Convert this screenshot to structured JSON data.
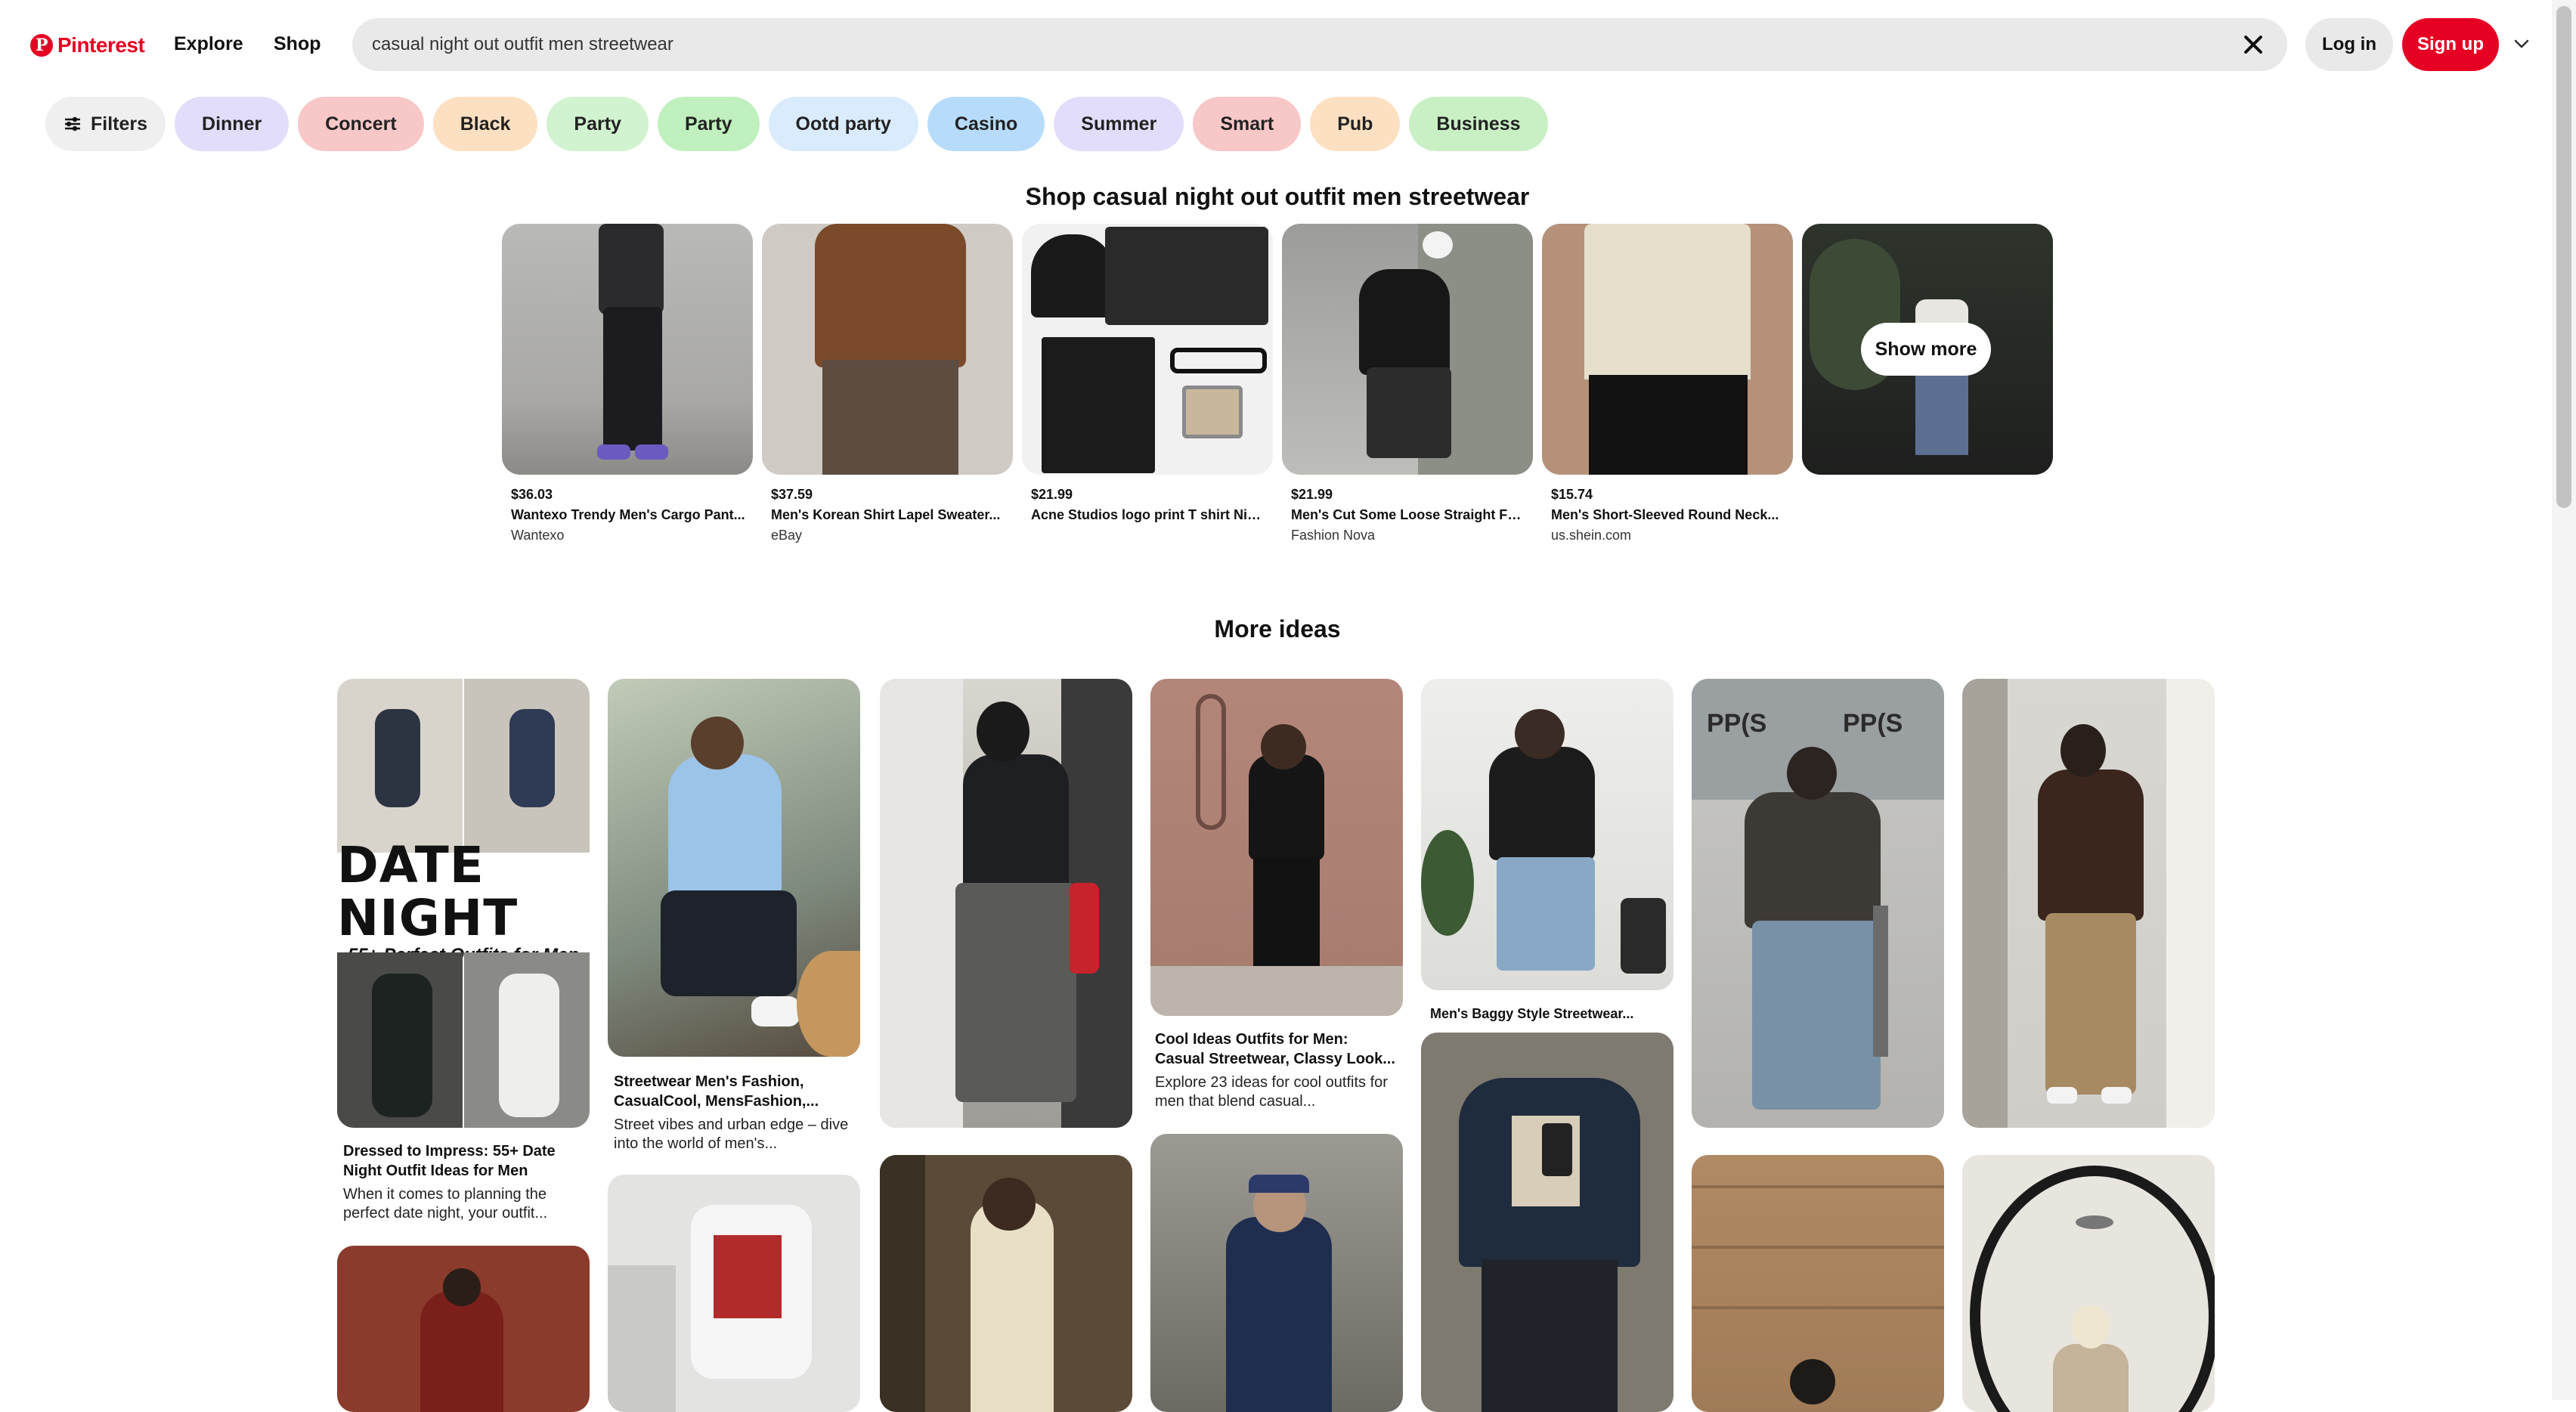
{
  "header": {
    "logo_text": "Pinterest",
    "nav": [
      "Explore",
      "Shop"
    ],
    "search_value": "casual night out outfit men streetwear",
    "login_label": "Log in",
    "signup_label": "Sign up",
    "brand_color": "#e60023"
  },
  "filters": {
    "filters_label": "Filters",
    "chips": [
      {
        "label": "Dinner",
        "color": "#e3ddfc"
      },
      {
        "label": "Concert",
        "color": "#f8c7c7"
      },
      {
        "label": "Black",
        "color": "#fde0c2"
      },
      {
        "label": "Party",
        "color": "#d2f3cf"
      },
      {
        "label": "Party",
        "color": "#bff0bd"
      },
      {
        "label": "Ootd party",
        "color": "#d9ebfd"
      },
      {
        "label": "Casino",
        "color": "#b7dcfb"
      },
      {
        "label": "Summer",
        "color": "#e3ddfc"
      },
      {
        "label": "Smart",
        "color": "#f8c7c7"
      },
      {
        "label": "Pub",
        "color": "#fde0c2"
      },
      {
        "label": "Business",
        "color": "#c9f0c5"
      }
    ]
  },
  "shop": {
    "title": "Shop casual night out outfit men streetwear",
    "show_more_label": "Show more",
    "products": [
      {
        "price": "$36.03",
        "name": "Wantexo Trendy Men's Cargo Pant...",
        "source": "Wantexo"
      },
      {
        "price": "$37.59",
        "name": "Men's Korean Shirt Lapel Sweater...",
        "source": "eBay"
      },
      {
        "price": "$21.99",
        "name": "Acne Studios logo print T shirt Nig...",
        "source": ""
      },
      {
        "price": "$21.99",
        "name": "Men's Cut Some Loose Straight Fa...",
        "source": "Fashion Nova"
      },
      {
        "price": "$15.74",
        "name": "Men's Short-Sleeved Round Neck...",
        "source": "us.shein.com"
      }
    ]
  },
  "more": {
    "title": "More ideas",
    "pins": [
      {
        "title": "Dressed to Impress: 55+ Date Night Outfit Ideas for Men",
        "desc": "When it comes to planning the perfect date night, your outfit..."
      },
      {
        "title": "Streetwear Men's Fashion, CasualCool, MensFashion,...",
        "desc": "Street vibes and urban edge – dive into the world of men's..."
      },
      {
        "title": "Cool Ideas Outfits for Men: Casual Streetwear, Classy Look...",
        "desc": "Explore 23 ideas for cool outfits for men that blend casual..."
      },
      {
        "title": "Men's Baggy Style Streetwear...",
        "desc": ""
      }
    ],
    "date_night_graphic": {
      "headline": "DATE NIGHT",
      "subline": "55+ Perfect Outfits for Men"
    },
    "shop_sign_text": "PP(S"
  }
}
